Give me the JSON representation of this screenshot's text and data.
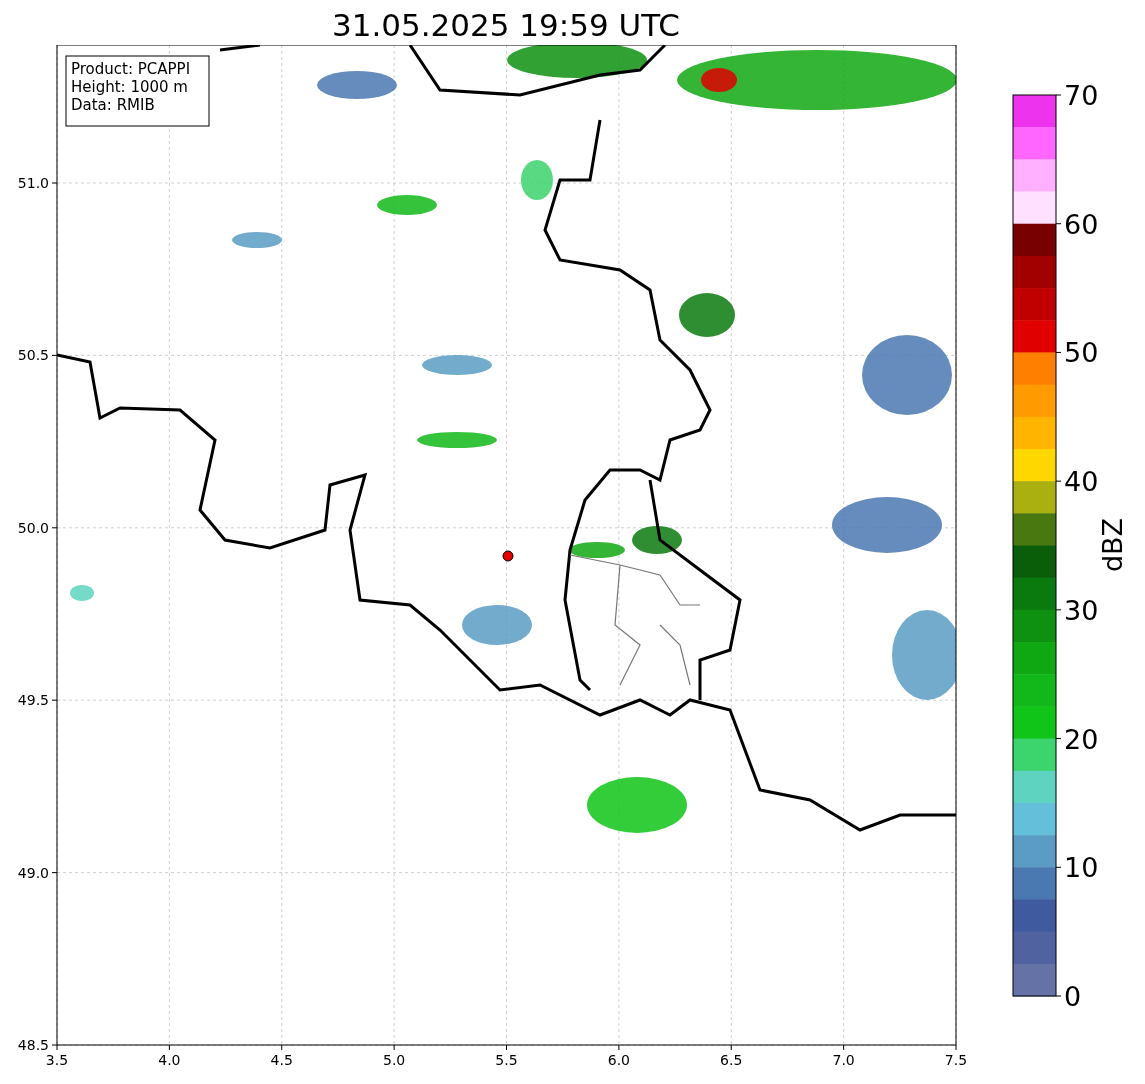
{
  "title": "31.05.2025 19:59 UTC",
  "info_box": {
    "lines": [
      "Product: PCAPPI",
      "Height: 1000 m",
      "Data: RMIB"
    ]
  },
  "axes": {
    "xticks": [
      "3.5",
      "4.0",
      "4.5",
      "5.0",
      "5.5",
      "6.0",
      "6.5",
      "7.0",
      "7.5"
    ],
    "yticks": [
      "51.0",
      "50.5",
      "50.0",
      "49.5",
      "49.0",
      "48.5"
    ]
  },
  "colorbar": {
    "label": "dBZ",
    "ticks": [
      "70",
      "60",
      "50",
      "40",
      "30",
      "20",
      "10",
      "0"
    ],
    "bins": [
      {
        "color": "#ee33ee"
      },
      {
        "color": "#ff66ff"
      },
      {
        "color": "#ffb0ff"
      },
      {
        "color": "#ffe0ff"
      },
      {
        "color": "#780000"
      },
      {
        "color": "#a00000"
      },
      {
        "color": "#c00000"
      },
      {
        "color": "#e00000"
      },
      {
        "color": "#ff7f00"
      },
      {
        "color": "#ff9a00"
      },
      {
        "color": "#ffb400"
      },
      {
        "color": "#ffd700"
      },
      {
        "color": "#aab010"
      },
      {
        "color": "#4a7810"
      },
      {
        "color": "#0a5e0a"
      },
      {
        "color": "#0b7a0e"
      },
      {
        "color": "#0e9010"
      },
      {
        "color": "#10a812"
      },
      {
        "color": "#12b81a"
      },
      {
        "color": "#10c418"
      },
      {
        "color": "#3cd46c"
      },
      {
        "color": "#5ed4c0"
      },
      {
        "color": "#64bfdb"
      },
      {
        "color": "#5b9cc4"
      },
      {
        "color": "#4a78b0"
      },
      {
        "color": "#405aa0"
      },
      {
        "color": "#5063a0"
      },
      {
        "color": "#6472a5"
      }
    ]
  }
}
